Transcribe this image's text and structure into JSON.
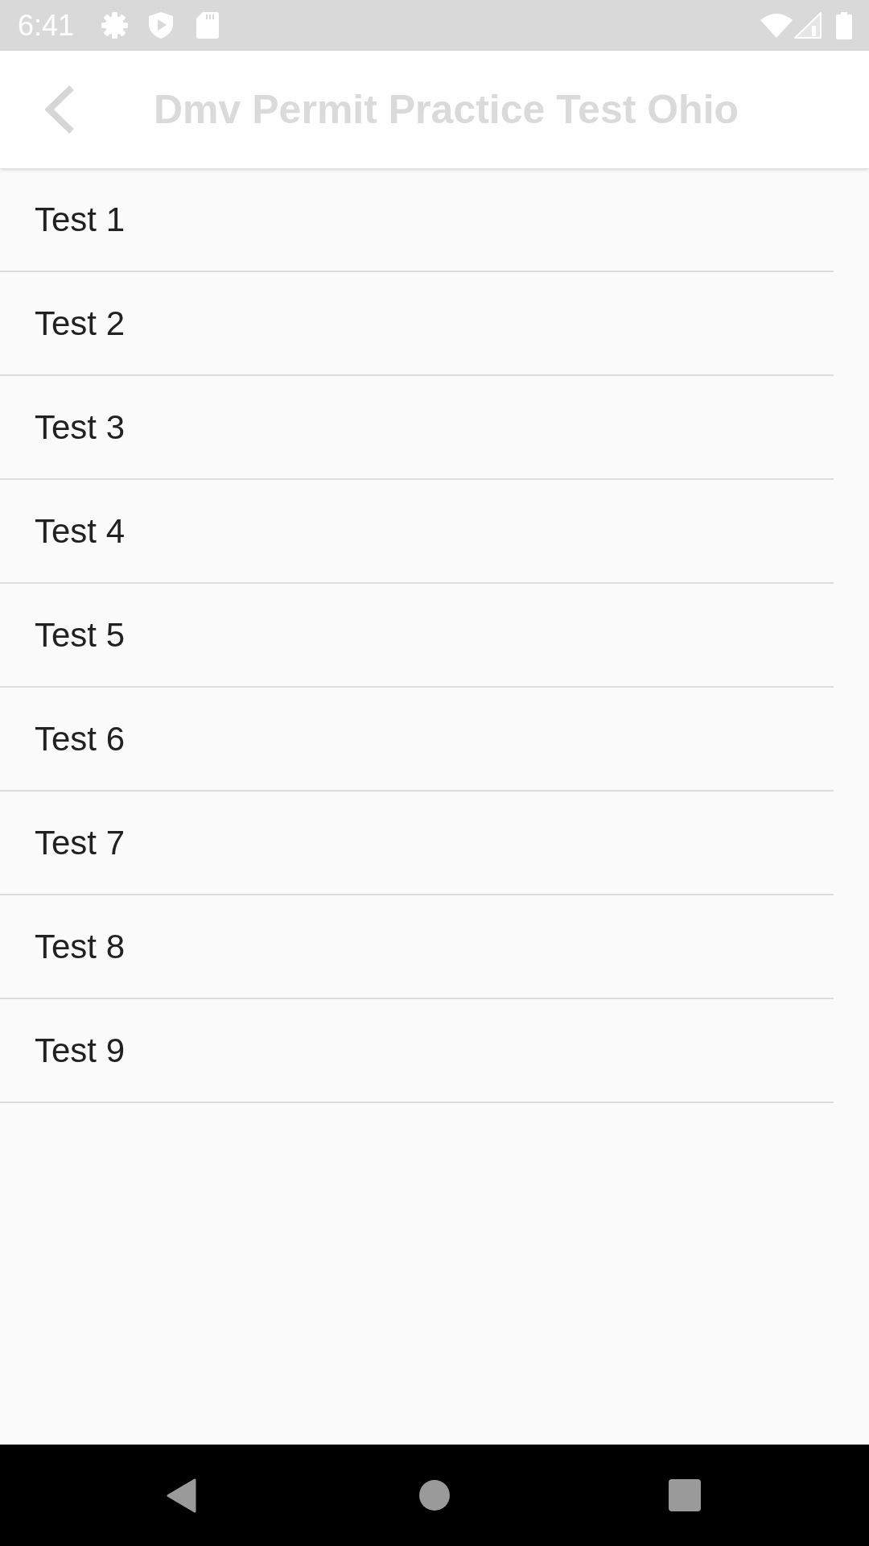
{
  "status_bar": {
    "time": "6:41"
  },
  "app_bar": {
    "title": "Dmv Permit Practice Test Ohio"
  },
  "tests": [
    {
      "label": "Test 1"
    },
    {
      "label": "Test 2"
    },
    {
      "label": "Test 3"
    },
    {
      "label": "Test 4"
    },
    {
      "label": "Test 5"
    },
    {
      "label": "Test 6"
    },
    {
      "label": "Test 7"
    },
    {
      "label": "Test 8"
    },
    {
      "label": "Test 9"
    }
  ]
}
